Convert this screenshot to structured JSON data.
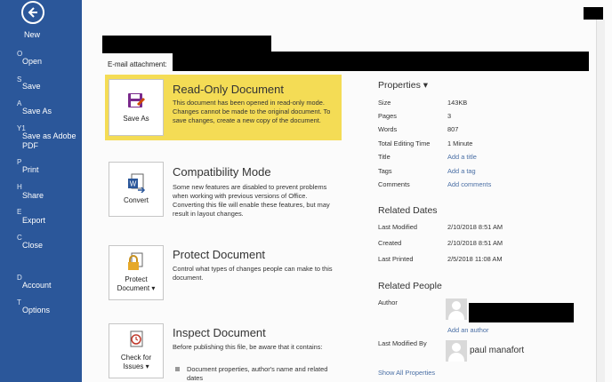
{
  "nav": {
    "new": "New",
    "items": [
      {
        "key": "O",
        "label": "Open"
      },
      {
        "key": "S",
        "label": "Save"
      },
      {
        "key": "A",
        "label": "Save As"
      },
      {
        "key": "Y1",
        "label": "Save as Adobe PDF"
      },
      {
        "key": "P",
        "label": "Print"
      },
      {
        "key": "H",
        "label": "Share"
      },
      {
        "key": "E",
        "label": "Export"
      },
      {
        "key": "C",
        "label": "Close"
      },
      {
        "key": "D",
        "label": "Account"
      },
      {
        "key": "T",
        "label": "Options"
      }
    ]
  },
  "attachment_label": "E-mail attachment:",
  "sections": {
    "readonly": {
      "button": "Save As",
      "title": "Read-Only Document",
      "text": "This document has been opened in read-only mode. Changes cannot be made to the original document. To save changes, create a new copy of the document."
    },
    "compat": {
      "button": "Convert",
      "title": "Compatibility Mode",
      "text": "Some new features are disabled to prevent problems when working with previous versions of Office. Converting this file will enable these features, but may result in layout changes."
    },
    "protect": {
      "button": "Protect Document ▾",
      "title": "Protect Document",
      "text": "Control what types of changes people can make to this document."
    },
    "inspect": {
      "button": "Check for Issues ▾",
      "title": "Inspect Document",
      "text": "Before publishing this file, be aware that it contains:",
      "bullet": "Document properties, author's name and related dates"
    }
  },
  "properties": {
    "heading": "Properties ▾",
    "rows": [
      {
        "key": "Size",
        "value": "143KB",
        "link": false
      },
      {
        "key": "Pages",
        "value": "3",
        "link": false
      },
      {
        "key": "Words",
        "value": "807",
        "link": false
      },
      {
        "key": "Total Editing Time",
        "value": "1 Minute",
        "link": false
      },
      {
        "key": "Title",
        "value": "Add a title",
        "link": true
      },
      {
        "key": "Tags",
        "value": "Add a tag",
        "link": true
      },
      {
        "key": "Comments",
        "value": "Add comments",
        "link": true
      }
    ]
  },
  "related_dates": {
    "heading": "Related Dates",
    "rows": [
      {
        "key": "Last Modified",
        "value": "2/10/2018 8:51 AM"
      },
      {
        "key": "Created",
        "value": "2/10/2018 8:51 AM"
      },
      {
        "key": "Last Printed",
        "value": "2/5/2018 11:08 AM"
      }
    ]
  },
  "related_people": {
    "heading": "Related People",
    "author_label": "Author",
    "add_author": "Add an author",
    "last_modified_by_label": "Last Modified By",
    "last_modified_by": "paul manafort",
    "show_all": "Show All Properties"
  },
  "colors": {
    "nav": "#2b579a",
    "highlight": "#f4dc55",
    "link": "#4a6fa5"
  }
}
